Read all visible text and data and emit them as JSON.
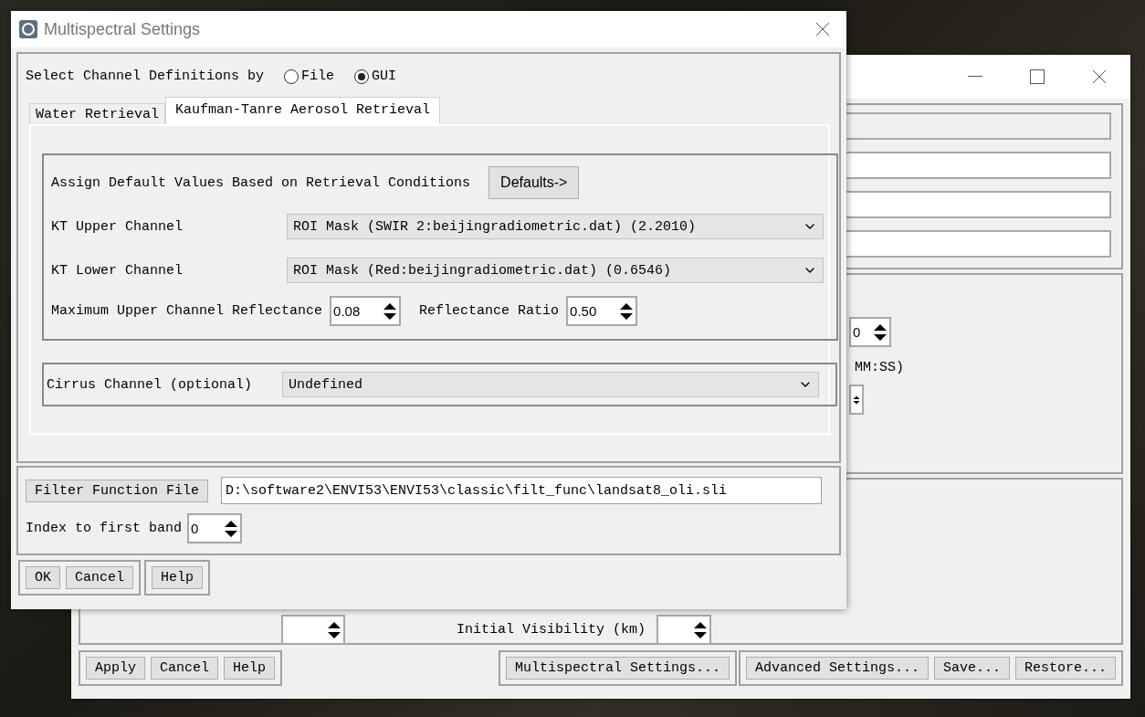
{
  "background_window": {
    "spinner_value": "0",
    "time_hint": "MM:SS)",
    "visibility_label": "Initial Visibility (km)",
    "button_groups": [
      {
        "buttons": [
          "Apply",
          "Cancel",
          "Help"
        ]
      },
      {
        "buttons": [
          "Multispectral Settings..."
        ]
      },
      {
        "buttons": [
          "Advanced Settings...",
          "Save...",
          "Restore..."
        ]
      }
    ]
  },
  "dialog": {
    "title": "Multispectral Settings",
    "channel_source": {
      "label": "Select Channel Definitions by",
      "options": [
        {
          "label": "File",
          "selected": false
        },
        {
          "label": "GUI",
          "selected": true
        }
      ]
    },
    "tabs": [
      {
        "label": "Water Retrieval",
        "selected": false
      },
      {
        "label": "Kaufman-Tanre Aerosol Retrieval",
        "selected": true
      }
    ],
    "defaults": {
      "label": "Assign Default Values Based on Retrieval Conditions",
      "button": "Defaults->"
    },
    "channels": [
      {
        "label": "KT Upper Channel",
        "value": "ROI Mask (SWIR 2:beijingradiometric.dat) (2.2010)"
      },
      {
        "label": "KT Lower Channel",
        "value": "ROI Mask (Red:beijingradiometric.dat) (0.6546)"
      }
    ],
    "reflectance": [
      {
        "label": "Maximum Upper Channel Reflectance",
        "value": "0.08"
      },
      {
        "label": "Reflectance Ratio",
        "value": "0.50"
      }
    ],
    "cirrus": {
      "label": "Cirrus Channel (optional)",
      "value": "Undefined"
    },
    "filter": {
      "button": "Filter Function File",
      "value": "D:\\software2\\ENVI53\\ENVI53\\classic\\filt_func\\landsat8_oli.sli"
    },
    "first_band": {
      "label": "Index to first band",
      "value": "0"
    },
    "button_groups": [
      {
        "buttons": [
          "OK",
          "Cancel"
        ]
      },
      {
        "buttons": [
          "Help"
        ]
      }
    ]
  }
}
